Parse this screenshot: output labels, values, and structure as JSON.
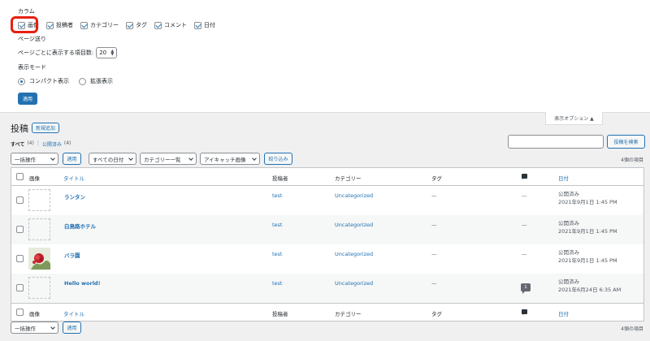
{
  "screen_options": {
    "columns_heading": "カラム",
    "columns": [
      {
        "label": "画像",
        "checked": true
      },
      {
        "label": "投稿者",
        "checked": true
      },
      {
        "label": "カテゴリー",
        "checked": true
      },
      {
        "label": "タグ",
        "checked": true
      },
      {
        "label": "コメント",
        "checked": true
      },
      {
        "label": "日付",
        "checked": true
      }
    ],
    "pagination_heading": "ページ送り",
    "per_page_label": "ページごとに表示する項目数:",
    "per_page_value": "20",
    "view_mode_heading": "表示モード",
    "view_modes": [
      {
        "label": "コンパクト表示",
        "selected": true
      },
      {
        "label": "拡張表示",
        "selected": false
      }
    ],
    "apply_label": "適用",
    "tab_label": "表示オプション ▲"
  },
  "header": {
    "title": "投稿",
    "add_new": "新規追加"
  },
  "views": {
    "all": "すべて",
    "all_count": "(4)",
    "sep": "|",
    "published": "公開済み",
    "published_count": "(4)"
  },
  "search": {
    "button": "投稿を検索"
  },
  "filters": {
    "bulk_action": "一括操作",
    "apply": "適用",
    "dates": "すべての日付",
    "categories": "カテゴリー一覧",
    "featured": "アイキャッチ画像",
    "filter_btn": "絞り込み",
    "count": "4個の項目"
  },
  "table": {
    "headers": {
      "image": "画像",
      "title": "タイトル",
      "author": "投稿者",
      "category": "カテゴリー",
      "tag": "タグ",
      "date": "日付"
    },
    "rows": [
      {
        "title": "ランタン",
        "author": "test",
        "category": "Uncategorized",
        "tag": "—",
        "comments": "—",
        "status": "公開済み",
        "date": "2021年9月1日 1:45 PM",
        "has_image": false
      },
      {
        "title": "白鳥路ホテル",
        "author": "test",
        "category": "Uncategorized",
        "tag": "—",
        "comments": "—",
        "status": "公開済み",
        "date": "2021年9月1日 1:45 PM",
        "has_image": false
      },
      {
        "title": "バラ園",
        "author": "test",
        "category": "Uncategorized",
        "tag": "—",
        "comments": "—",
        "status": "公開済み",
        "date": "2021年9月1日 1:45 PM",
        "has_image": true
      },
      {
        "title": "Hello world!",
        "author": "test",
        "category": "Uncategorized",
        "tag": "—",
        "comments": "1",
        "status": "公開済み",
        "date": "2021年6月24日 6:35 AM",
        "has_image": false
      }
    ]
  },
  "bottom": {
    "bulk_action": "一括操作",
    "apply": "適用",
    "count": "4個の項目"
  },
  "colors": {
    "accent": "#2271b1",
    "highlight": "#e8200f"
  }
}
